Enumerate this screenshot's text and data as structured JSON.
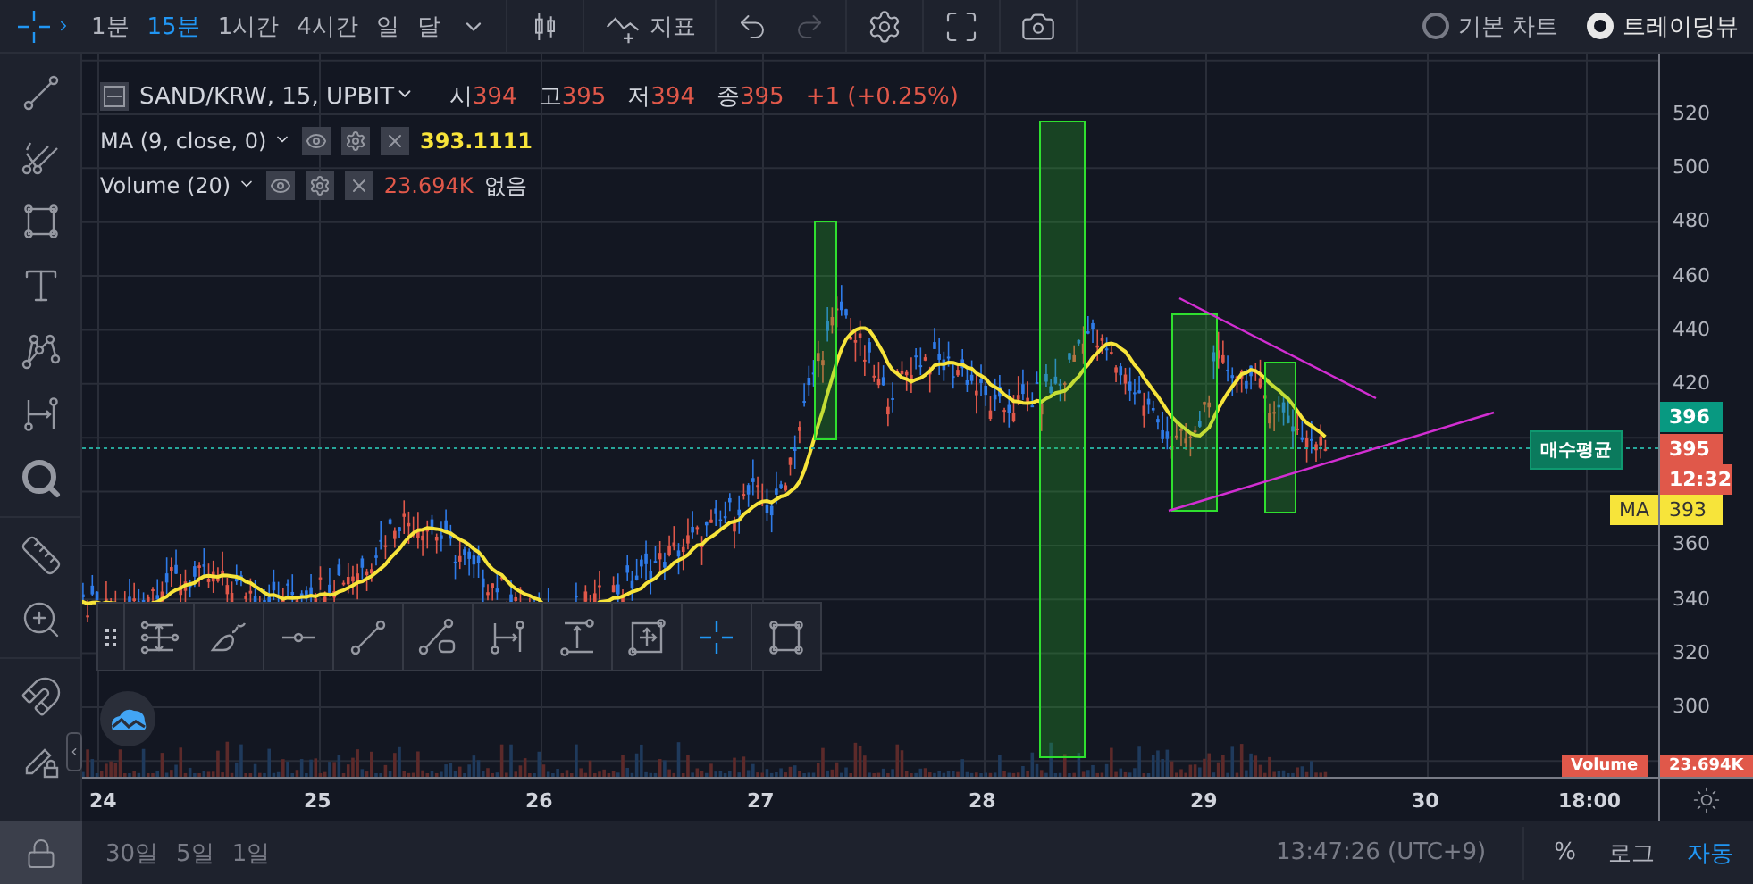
{
  "toolbar": {
    "intervals": [
      {
        "label": "1분",
        "selected": false
      },
      {
        "label": "15분",
        "selected": true
      },
      {
        "label": "1시간",
        "selected": false
      },
      {
        "label": "4시간",
        "selected": false
      },
      {
        "label": "일",
        "selected": false
      },
      {
        "label": "달",
        "selected": false
      }
    ],
    "indicators_label": "지표",
    "chart_styles": [
      {
        "label": "기본 차트",
        "selected": false
      },
      {
        "label": "트레이딩뷰",
        "selected": true
      }
    ]
  },
  "left_toolbar": {
    "tools": [
      {
        "kind": "line",
        "selected": false
      },
      {
        "kind": "pitchfork",
        "selected": false
      },
      {
        "kind": "rectangle",
        "selected": false
      },
      {
        "kind": "text",
        "selected": false
      },
      {
        "kind": "pattern",
        "selected": false
      },
      {
        "kind": "measure",
        "selected": false
      },
      {
        "kind": "zoom",
        "selected": false
      },
      {
        "kind": "ruler",
        "selected": false
      },
      {
        "kind": "zoomin",
        "selected": false
      },
      {
        "kind": "magnet",
        "selected": false
      },
      {
        "kind": "lockpen",
        "selected": false
      }
    ]
  },
  "legend": {
    "symbol": "SAND/KRW, 15, UPBIT",
    "ohlc": [
      {
        "label": "시",
        "value": "394"
      },
      {
        "label": "고",
        "value": "395"
      },
      {
        "label": "저",
        "value": "394"
      },
      {
        "label": "종",
        "value": "395"
      }
    ],
    "change": "+1 (+0.25%)",
    "indicators": [
      {
        "name": "MA (9, close, 0)",
        "value": "393.1111",
        "color": "#f7e43a"
      },
      {
        "name": "Volume (20)",
        "value": "23.694K",
        "color": "#e0584a",
        "extra": "없음"
      }
    ]
  },
  "position_line": {
    "label": "매수평균"
  },
  "drawing_toolbar": {
    "tools": [
      {
        "kind": "levels",
        "selected": false
      },
      {
        "kind": "brush",
        "selected": false
      },
      {
        "kind": "hline",
        "selected": false
      },
      {
        "kind": "trend",
        "selected": false
      },
      {
        "kind": "ray",
        "selected": false
      },
      {
        "kind": "daterange",
        "selected": false
      },
      {
        "kind": "pricerange",
        "selected": false
      },
      {
        "kind": "both",
        "selected": false
      },
      {
        "kind": "cross",
        "selected": true
      },
      {
        "kind": "rect",
        "selected": false
      }
    ]
  },
  "price_axis": {
    "ticks_upper": [
      "520",
      "500",
      "480",
      "460",
      "440",
      "420"
    ],
    "ticks_lower": [
      "360",
      "340",
      "320",
      "300"
    ],
    "markers": [
      {
        "kind": "price",
        "label": "396",
        "color": "#089981"
      },
      {
        "kind": "price",
        "label": "395",
        "color": "#e0584a"
      },
      {
        "kind": "countdown",
        "label": "12:32",
        "color": "#e0584a"
      },
      {
        "kind": "indicator",
        "name": "MA",
        "label": "393",
        "color": "#f7e43a"
      }
    ],
    "volume_marker": {
      "name": "Volume",
      "label": "23.694K"
    }
  },
  "time_axis": {
    "labels": [
      "24",
      "25",
      "26",
      "27",
      "28",
      "29",
      "30",
      "18:00"
    ]
  },
  "bottom_bar": {
    "ranges": [
      "30일",
      "5일",
      "1일"
    ],
    "clock": "13:47:26 (UTC+9)",
    "scale_options": [
      {
        "label": "%",
        "selected": false
      },
      {
        "label": "로그",
        "selected": false
      },
      {
        "label": "자동",
        "selected": true
      }
    ]
  }
}
